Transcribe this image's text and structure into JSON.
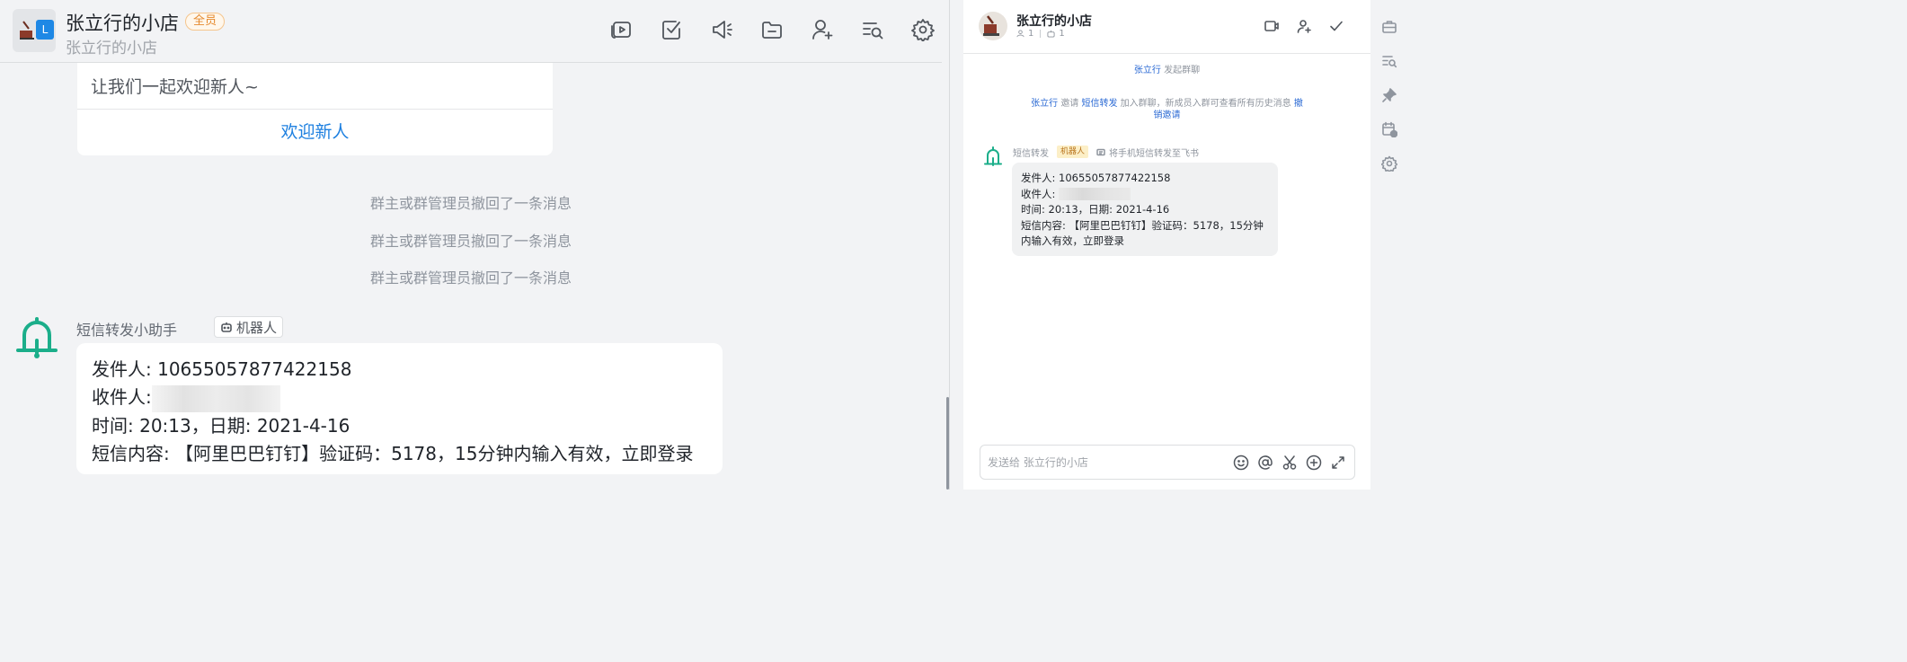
{
  "left_chat": {
    "title": "张立行的小店",
    "member_badge": "全员",
    "subtitle": "张立行的小店",
    "avatar_badge": "L",
    "toolbar_icons": [
      "video-meeting-icon",
      "task-icon",
      "announcement-icon",
      "folder-icon",
      "add-member-icon",
      "search-history-icon",
      "settings-icon"
    ],
    "welcome_card": {
      "text": "让我们一起欢迎新人~",
      "button": "欢迎新人"
    },
    "recalls": [
      "群主或群管理员撤回了一条消息",
      "群主或群管理员撤回了一条消息",
      "群主或群管理员撤回了一条消息"
    ],
    "bot_message": {
      "sender": "短信转发小助手",
      "tag": "机器人",
      "lines": {
        "from_label": "发件人: ",
        "from_value": "10655057877422158",
        "to_label": "收件人:",
        "time": "时间: 20:13，日期: 2021-4-16",
        "content": "短信内容: 【阿里巴巴钉钉】验证码：5178，15分钟内输入有效，立即登录"
      }
    }
  },
  "right_chat": {
    "title": "张立行的小店",
    "member_count": "1",
    "bot_count": "1",
    "header_icons": [
      "video-icon",
      "add-member-icon",
      "done-icon"
    ],
    "system1": {
      "actor": "张立行",
      "text": " 发起群聊"
    },
    "system2": {
      "actor": "张立行",
      "verb": " 邀请 ",
      "target": "短信转发",
      "text": " 加入群聊，新成员入群可查看所有历史消息 ",
      "link": "撤销邀请"
    },
    "bot_message": {
      "sender": "短信转发",
      "tag": "机器人",
      "note": "将手机短信转发至飞书",
      "lines": {
        "from": "发件人: 10655057877422158",
        "to_label": "收件人:",
        "time": "时间: 20:13，日期: 2021-4-16",
        "content": "短信内容: 【阿里巴巴钉钉】验证码：5178，15分钟内输入有效，立即登录"
      }
    },
    "input_placeholder": "发送给 张立行的小店",
    "input_icons": [
      "emoji-icon",
      "mention-icon",
      "scissors-icon",
      "plus-circle-icon",
      "expand-icon"
    ]
  },
  "right_rail_icons": [
    "briefcase-icon",
    "search-history-icon",
    "pin-icon",
    "calendar-add-icon",
    "settings-icon"
  ]
}
